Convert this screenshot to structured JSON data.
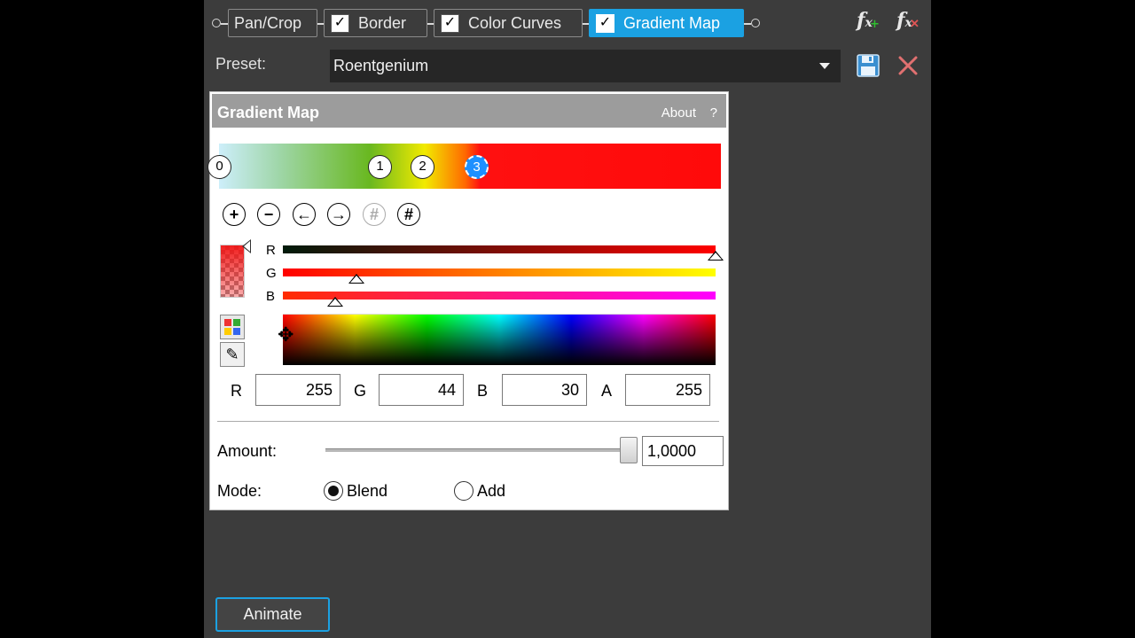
{
  "fx_chain": {
    "tabs": [
      {
        "label": "Pan/Crop",
        "has_checkbox": false,
        "checked": false,
        "active": false
      },
      {
        "label": "Border",
        "has_checkbox": true,
        "checked": true,
        "active": false
      },
      {
        "label": "Color Curves",
        "has_checkbox": true,
        "checked": true,
        "active": false
      },
      {
        "label": "Gradient Map",
        "has_checkbox": true,
        "checked": true,
        "active": true
      }
    ],
    "add_fx_icon": "fx-add-icon",
    "remove_fx_icon": "fx-remove-icon",
    "checkmark": "✓"
  },
  "preset": {
    "label": "Preset:",
    "value": "Roentgenium",
    "save_icon": "floppy-disk-icon",
    "delete_icon": "close-icon"
  },
  "panel": {
    "title": "Gradient Map",
    "about": "About",
    "help": "?",
    "gradient_stops": [
      {
        "label": "0",
        "position": 0.0
      },
      {
        "label": "1",
        "position": 0.32
      },
      {
        "label": "2",
        "position": 0.405
      },
      {
        "label": "3",
        "position": 0.515,
        "selected": true
      }
    ],
    "tools": [
      {
        "name": "add-stop-icon",
        "glyph": "+",
        "enabled": true
      },
      {
        "name": "remove-stop-icon",
        "glyph": "−",
        "enabled": true
      },
      {
        "name": "move-left-icon",
        "glyph": "←",
        "enabled": true
      },
      {
        "name": "move-right-icon",
        "glyph": "→",
        "enabled": true
      },
      {
        "name": "distribute-icon",
        "glyph": "#",
        "enabled": false
      },
      {
        "name": "reverse-icon",
        "glyph": "#",
        "enabled": true
      }
    ],
    "channels": [
      {
        "label": "R",
        "fraction": 1.0,
        "gradient_from": "#001a0a",
        "gradient_to": "#ff0000"
      },
      {
        "label": "G",
        "fraction": 0.17,
        "gradient_from": "#ff0000",
        "gradient_to": "#ffff00"
      },
      {
        "label": "B",
        "fraction": 0.12,
        "gradient_from": "#ff2c00",
        "gradient_to": "#ff00ff"
      }
    ],
    "values": [
      {
        "label": "R",
        "value": "255"
      },
      {
        "label": "G",
        "value": "44"
      },
      {
        "label": "B",
        "value": "30"
      },
      {
        "label": "A",
        "value": "255"
      }
    ],
    "amount": {
      "label": "Amount:",
      "value": "1,0000",
      "fraction": 1.0
    },
    "mode": {
      "label": "Mode:",
      "options": [
        {
          "label": "Blend",
          "selected": true
        },
        {
          "label": "Add",
          "selected": false
        }
      ]
    }
  },
  "animate_label": "Animate",
  "colors": {
    "accent": "#1ba1e2",
    "background": "#3c3c3c"
  }
}
